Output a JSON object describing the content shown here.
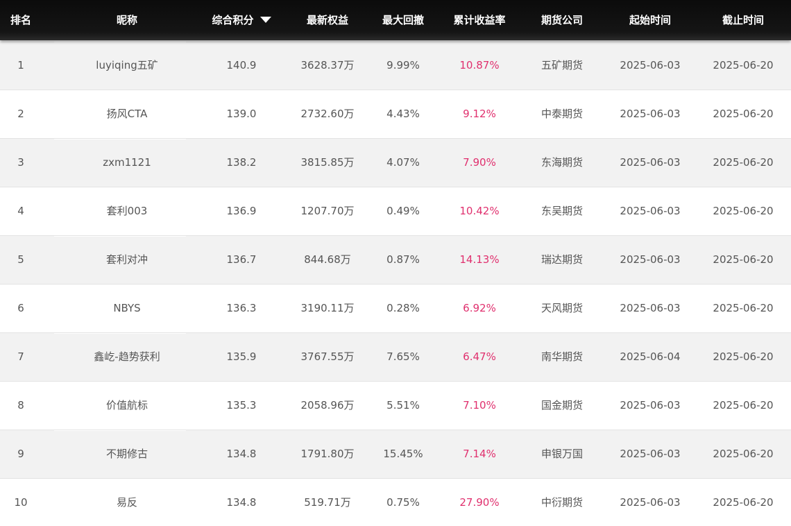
{
  "header": {
    "rank": "排名",
    "nickname": "昵称",
    "score": "综合积分",
    "equity": "最新权益",
    "drawdown": "最大回撤",
    "return": "累计收益率",
    "company": "期货公司",
    "start": "起始时间",
    "end": "截止时间"
  },
  "sort": {
    "column": "score",
    "direction": "descending",
    "icon": "caret-down-icon"
  },
  "colors": {
    "header_bg": "#111111",
    "return_text": "#e0306e",
    "odd_row_bg": "#f2f2f2"
  },
  "rows": [
    {
      "rank": "1",
      "nickname": "luyiqing五矿",
      "score": "140.9",
      "equity": "3628.37万",
      "drawdown": "9.99%",
      "return": "10.87%",
      "company": "五矿期货",
      "start": "2025-06-03",
      "end": "2025-06-20"
    },
    {
      "rank": "2",
      "nickname": "扬风CTA",
      "score": "139.0",
      "equity": "2732.60万",
      "drawdown": "4.43%",
      "return": "9.12%",
      "company": "中泰期货",
      "start": "2025-06-03",
      "end": "2025-06-20"
    },
    {
      "rank": "3",
      "nickname": "zxm1121",
      "score": "138.2",
      "equity": "3815.85万",
      "drawdown": "4.07%",
      "return": "7.90%",
      "company": "东海期货",
      "start": "2025-06-03",
      "end": "2025-06-20"
    },
    {
      "rank": "4",
      "nickname": "套利003",
      "score": "136.9",
      "equity": "1207.70万",
      "drawdown": "0.49%",
      "return": "10.42%",
      "company": "东吴期货",
      "start": "2025-06-03",
      "end": "2025-06-20"
    },
    {
      "rank": "5",
      "nickname": "套利对冲",
      "score": "136.7",
      "equity": "844.68万",
      "drawdown": "0.87%",
      "return": "14.13%",
      "company": "瑞达期货",
      "start": "2025-06-03",
      "end": "2025-06-20"
    },
    {
      "rank": "6",
      "nickname": "NBYS",
      "score": "136.3",
      "equity": "3190.11万",
      "drawdown": "0.28%",
      "return": "6.92%",
      "company": "天风期货",
      "start": "2025-06-03",
      "end": "2025-06-20"
    },
    {
      "rank": "7",
      "nickname": "鑫屹-趋势获利",
      "score": "135.9",
      "equity": "3767.55万",
      "drawdown": "7.65%",
      "return": "6.47%",
      "company": "南华期货",
      "start": "2025-06-04",
      "end": "2025-06-20"
    },
    {
      "rank": "8",
      "nickname": "价值航标",
      "score": "135.3",
      "equity": "2058.96万",
      "drawdown": "5.51%",
      "return": "7.10%",
      "company": "国金期货",
      "start": "2025-06-03",
      "end": "2025-06-20"
    },
    {
      "rank": "9",
      "nickname": "不期修古",
      "score": "134.8",
      "equity": "1791.80万",
      "drawdown": "15.45%",
      "return": "7.14%",
      "company": "申银万国",
      "start": "2025-06-03",
      "end": "2025-06-20"
    },
    {
      "rank": "10",
      "nickname": "易反",
      "score": "134.8",
      "equity": "519.71万",
      "drawdown": "0.75%",
      "return": "27.90%",
      "company": "中衍期货",
      "start": "2025-06-03",
      "end": "2025-06-20"
    }
  ]
}
